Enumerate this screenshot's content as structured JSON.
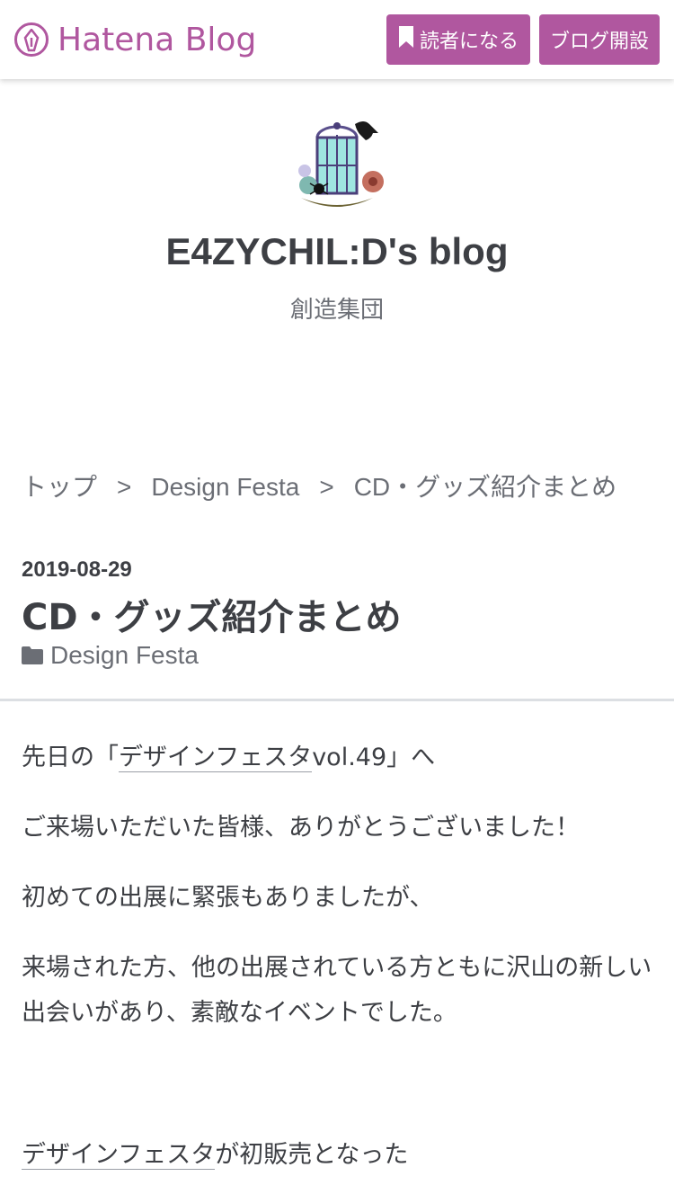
{
  "topbar": {
    "logo_text": "Hatena Blog",
    "subscribe_label": "読者になる",
    "open_blog_label": "ブログ開設",
    "accent_color": "#b0579f"
  },
  "blog": {
    "title": "E4ZYCHIL:D's blog",
    "description": "創造集団"
  },
  "breadcrumb": {
    "items": [
      "トップ",
      "Design Festa",
      "CD・グッズ紹介まとめ"
    ],
    "separator": ">"
  },
  "entry": {
    "date": "2019-08-29",
    "title": "CD・グッズ紹介まとめ",
    "category": "Design Festa"
  },
  "body": {
    "p1_prefix": "先日の「",
    "p1_link": "デザインフェスタ",
    "p1_suffix": "vol.49」へ",
    "p2": "ご来場いただいた皆様、ありがとうございました！",
    "p3": "初めての出展に緊張もありましたが、",
    "p4": "来場された方、他の出展されている方ともに沢山の新しい出会いがあり、素敵なイベントでした。",
    "p5_link": "デザインフェスタ",
    "p5_suffix": "が初販売となった"
  }
}
